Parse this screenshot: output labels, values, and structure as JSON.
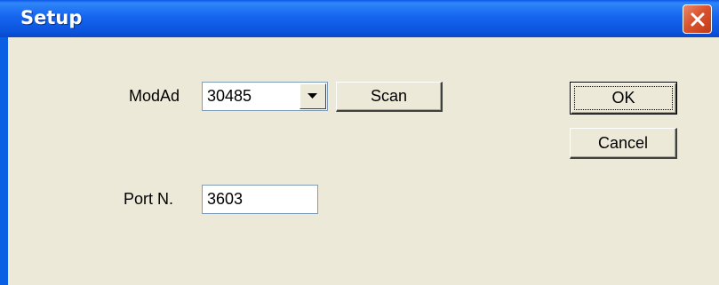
{
  "window": {
    "title": "Setup"
  },
  "form": {
    "modad_label": "ModAd",
    "modad_value": "30485",
    "scan_label": "Scan",
    "port_label": "Port N.",
    "port_value": "3603"
  },
  "buttons": {
    "ok_label": "OK",
    "cancel_label": "Cancel"
  },
  "colors": {
    "titlebar": "#0b54dc",
    "client": "#ece9d8",
    "close": "#d9542e",
    "field_border": "#7f9db9"
  },
  "icons": {
    "close": "close-x-icon",
    "dropdown": "triangle-down-icon"
  }
}
